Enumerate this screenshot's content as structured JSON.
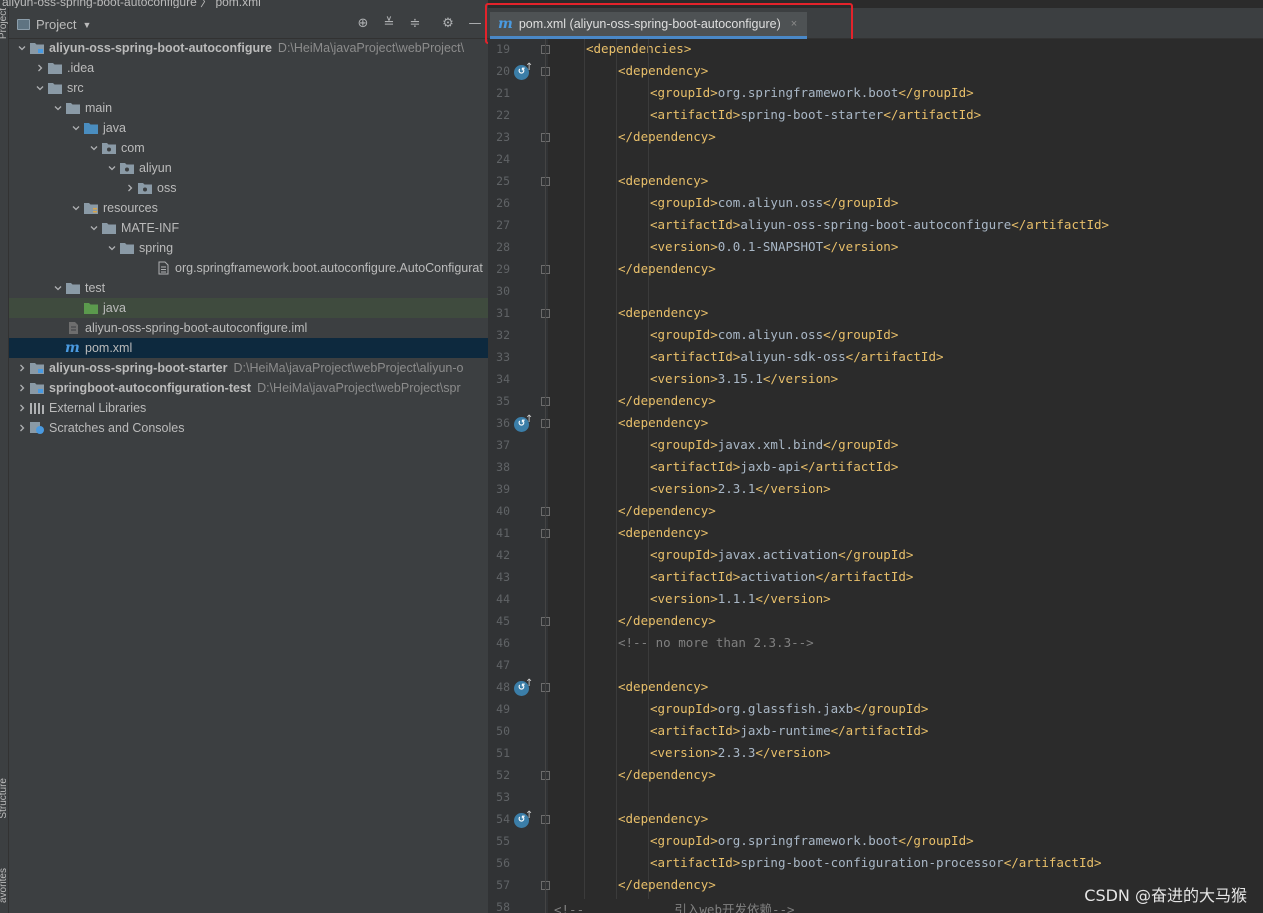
{
  "breadcrumb": {
    "text": "aliyun-oss-spring-boot-autoconfigure  〉 pom.xml"
  },
  "tool_strip": {
    "top_label": "Project",
    "mid_label": "Structure",
    "bottom_label": "avorites"
  },
  "project_panel": {
    "title": "Project",
    "tree": [
      {
        "name": "aliyun-oss-spring-boot-autoconfigure",
        "path": "D:\\HeiMa\\javaProject\\webProject\\",
        "bold": true,
        "indent": 0,
        "chevron": "down",
        "icon": "module-folder",
        "state": ""
      },
      {
        "name": ".idea",
        "path": "",
        "bold": false,
        "indent": 1,
        "chevron": "right",
        "icon": "folder",
        "state": ""
      },
      {
        "name": "src",
        "path": "",
        "bold": false,
        "indent": 1,
        "chevron": "down",
        "icon": "folder",
        "state": ""
      },
      {
        "name": "main",
        "path": "",
        "bold": false,
        "indent": 2,
        "chevron": "down",
        "icon": "folder",
        "state": ""
      },
      {
        "name": "java",
        "path": "",
        "bold": false,
        "indent": 3,
        "chevron": "down",
        "icon": "source-folder",
        "state": ""
      },
      {
        "name": "com",
        "path": "",
        "bold": false,
        "indent": 4,
        "chevron": "down",
        "icon": "package",
        "state": ""
      },
      {
        "name": "aliyun",
        "path": "",
        "bold": false,
        "indent": 5,
        "chevron": "down",
        "icon": "package",
        "state": ""
      },
      {
        "name": "oss",
        "path": "",
        "bold": false,
        "indent": 6,
        "chevron": "right",
        "icon": "package",
        "state": ""
      },
      {
        "name": "resources",
        "path": "",
        "bold": false,
        "indent": 3,
        "chevron": "down",
        "icon": "resources-folder",
        "state": ""
      },
      {
        "name": "MATE-INF",
        "path": "",
        "bold": false,
        "indent": 4,
        "chevron": "down",
        "icon": "folder",
        "state": ""
      },
      {
        "name": "spring",
        "path": "",
        "bold": false,
        "indent": 5,
        "chevron": "down",
        "icon": "folder",
        "state": ""
      },
      {
        "name": "org.springframework.boot.autoconfigure.AutoConfigurat",
        "path": "",
        "bold": false,
        "indent": 7,
        "chevron": "none",
        "icon": "text-file",
        "state": ""
      },
      {
        "name": "test",
        "path": "",
        "bold": false,
        "indent": 2,
        "chevron": "down",
        "icon": "folder",
        "state": ""
      },
      {
        "name": "java",
        "path": "",
        "bold": false,
        "indent": 3,
        "chevron": "none",
        "icon": "test-folder",
        "state": "green"
      },
      {
        "name": "aliyun-oss-spring-boot-autoconfigure.iml",
        "path": "",
        "bold": false,
        "indent": 2,
        "chevron": "none",
        "icon": "iml-file",
        "state": ""
      },
      {
        "name": "pom.xml",
        "path": "",
        "bold": false,
        "indent": 2,
        "chevron": "none",
        "icon": "maven-file",
        "state": "blue"
      },
      {
        "name": "aliyun-oss-spring-boot-starter",
        "path": "D:\\HeiMa\\javaProject\\webProject\\aliyun-o",
        "bold": true,
        "indent": 0,
        "chevron": "right",
        "icon": "module-folder",
        "state": ""
      },
      {
        "name": "springboot-autoconfiguration-test",
        "path": "D:\\HeiMa\\javaProject\\webProject\\spr",
        "bold": true,
        "indent": 0,
        "chevron": "right",
        "icon": "module-folder",
        "state": ""
      },
      {
        "name": "External Libraries",
        "path": "",
        "bold": false,
        "indent": 0,
        "chevron": "right",
        "icon": "libraries",
        "state": ""
      },
      {
        "name": "Scratches and Consoles",
        "path": "",
        "bold": false,
        "indent": 0,
        "chevron": "right",
        "icon": "scratches",
        "state": ""
      }
    ]
  },
  "editor": {
    "tab_label": "pom.xml (aliyun-oss-spring-boot-autoconfigure)",
    "tab_close": "×",
    "lines": [
      {
        "n": "19",
        "indent": 1,
        "parts": [
          [
            "t",
            "<dependencies>"
          ]
        ],
        "fold": true,
        "mark": false
      },
      {
        "n": "20",
        "indent": 2,
        "parts": [
          [
            "t",
            "<dependency>"
          ]
        ],
        "fold": true,
        "mark": true
      },
      {
        "n": "21",
        "indent": 3,
        "parts": [
          [
            "t",
            "<groupId>"
          ],
          [
            "x",
            "org.springframework.boot"
          ],
          [
            "t",
            "</groupId>"
          ]
        ],
        "fold": false,
        "mark": false
      },
      {
        "n": "22",
        "indent": 3,
        "parts": [
          [
            "t",
            "<artifactId>"
          ],
          [
            "x",
            "spring-boot-starter"
          ],
          [
            "t",
            "</artifactId>"
          ]
        ],
        "fold": false,
        "mark": false
      },
      {
        "n": "23",
        "indent": 2,
        "parts": [
          [
            "t",
            "</dependency>"
          ]
        ],
        "fold": true,
        "mark": false
      },
      {
        "n": "24",
        "indent": 0,
        "parts": [],
        "fold": false,
        "mark": false
      },
      {
        "n": "25",
        "indent": 2,
        "parts": [
          [
            "t",
            "<dependency>"
          ]
        ],
        "fold": true,
        "mark": false
      },
      {
        "n": "26",
        "indent": 3,
        "parts": [
          [
            "t",
            "<groupId>"
          ],
          [
            "x",
            "com.aliyun.oss"
          ],
          [
            "t",
            "</groupId>"
          ]
        ],
        "fold": false,
        "mark": false
      },
      {
        "n": "27",
        "indent": 3,
        "parts": [
          [
            "t",
            "<artifactId>"
          ],
          [
            "x",
            "aliyun-oss-spring-boot-autoconfigure"
          ],
          [
            "t",
            "</artifactId>"
          ]
        ],
        "fold": false,
        "mark": false
      },
      {
        "n": "28",
        "indent": 3,
        "parts": [
          [
            "t",
            "<version>"
          ],
          [
            "x",
            "0.0.1-SNAPSHOT"
          ],
          [
            "t",
            "</version>"
          ]
        ],
        "fold": false,
        "mark": false
      },
      {
        "n": "29",
        "indent": 2,
        "parts": [
          [
            "t",
            "</dependency>"
          ]
        ],
        "fold": true,
        "mark": false
      },
      {
        "n": "30",
        "indent": 0,
        "parts": [],
        "fold": false,
        "mark": false
      },
      {
        "n": "31",
        "indent": 2,
        "parts": [
          [
            "t",
            "<dependency>"
          ]
        ],
        "fold": true,
        "mark": false
      },
      {
        "n": "32",
        "indent": 3,
        "parts": [
          [
            "t",
            "<groupId>"
          ],
          [
            "x",
            "com.aliyun.oss"
          ],
          [
            "t",
            "</groupId>"
          ]
        ],
        "fold": false,
        "mark": false
      },
      {
        "n": "33",
        "indent": 3,
        "parts": [
          [
            "t",
            "<artifactId>"
          ],
          [
            "x",
            "aliyun-sdk-oss"
          ],
          [
            "t",
            "</artifactId>"
          ]
        ],
        "fold": false,
        "mark": false
      },
      {
        "n": "34",
        "indent": 3,
        "parts": [
          [
            "t",
            "<version>"
          ],
          [
            "x",
            "3.15.1"
          ],
          [
            "t",
            "</version>"
          ]
        ],
        "fold": false,
        "mark": false
      },
      {
        "n": "35",
        "indent": 2,
        "parts": [
          [
            "t",
            "</dependency>"
          ]
        ],
        "fold": true,
        "mark": false
      },
      {
        "n": "36",
        "indent": 2,
        "parts": [
          [
            "t",
            "<dependency>"
          ]
        ],
        "fold": true,
        "mark": true
      },
      {
        "n": "37",
        "indent": 3,
        "parts": [
          [
            "t",
            "<groupId>"
          ],
          [
            "x",
            "javax.xml.bind"
          ],
          [
            "t",
            "</groupId>"
          ]
        ],
        "fold": false,
        "mark": false
      },
      {
        "n": "38",
        "indent": 3,
        "parts": [
          [
            "t",
            "<artifactId>"
          ],
          [
            "x",
            "jaxb-api"
          ],
          [
            "t",
            "</artifactId>"
          ]
        ],
        "fold": false,
        "mark": false
      },
      {
        "n": "39",
        "indent": 3,
        "parts": [
          [
            "t",
            "<version>"
          ],
          [
            "x",
            "2.3.1"
          ],
          [
            "t",
            "</version>"
          ]
        ],
        "fold": false,
        "mark": false
      },
      {
        "n": "40",
        "indent": 2,
        "parts": [
          [
            "t",
            "</dependency>"
          ]
        ],
        "fold": true,
        "mark": false
      },
      {
        "n": "41",
        "indent": 2,
        "parts": [
          [
            "t",
            "<dependency>"
          ]
        ],
        "fold": true,
        "mark": false
      },
      {
        "n": "42",
        "indent": 3,
        "parts": [
          [
            "t",
            "<groupId>"
          ],
          [
            "x",
            "javax.activation"
          ],
          [
            "t",
            "</groupId>"
          ]
        ],
        "fold": false,
        "mark": false
      },
      {
        "n": "43",
        "indent": 3,
        "parts": [
          [
            "t",
            "<artifactId>"
          ],
          [
            "x",
            "activation"
          ],
          [
            "t",
            "</artifactId>"
          ]
        ],
        "fold": false,
        "mark": false
      },
      {
        "n": "44",
        "indent": 3,
        "parts": [
          [
            "t",
            "<version>"
          ],
          [
            "x",
            "1.1.1"
          ],
          [
            "t",
            "</version>"
          ]
        ],
        "fold": false,
        "mark": false
      },
      {
        "n": "45",
        "indent": 2,
        "parts": [
          [
            "t",
            "</dependency>"
          ]
        ],
        "fold": true,
        "mark": false
      },
      {
        "n": "46",
        "indent": 2,
        "parts": [
          [
            "c",
            "<!-- no more than 2.3.3-->"
          ]
        ],
        "fold": false,
        "mark": false
      },
      {
        "n": "47",
        "indent": 0,
        "parts": [],
        "fold": false,
        "mark": false
      },
      {
        "n": "48",
        "indent": 2,
        "parts": [
          [
            "t",
            "<dependency>"
          ]
        ],
        "fold": true,
        "mark": true
      },
      {
        "n": "49",
        "indent": 3,
        "parts": [
          [
            "t",
            "<groupId>"
          ],
          [
            "x",
            "org.glassfish.jaxb"
          ],
          [
            "t",
            "</groupId>"
          ]
        ],
        "fold": false,
        "mark": false
      },
      {
        "n": "50",
        "indent": 3,
        "parts": [
          [
            "t",
            "<artifactId>"
          ],
          [
            "x",
            "jaxb-runtime"
          ],
          [
            "t",
            "</artifactId>"
          ]
        ],
        "fold": false,
        "mark": false
      },
      {
        "n": "51",
        "indent": 3,
        "parts": [
          [
            "t",
            "<version>"
          ],
          [
            "x",
            "2.3.3"
          ],
          [
            "t",
            "</version>"
          ]
        ],
        "fold": false,
        "mark": false
      },
      {
        "n": "52",
        "indent": 2,
        "parts": [
          [
            "t",
            "</dependency>"
          ]
        ],
        "fold": true,
        "mark": false
      },
      {
        "n": "53",
        "indent": 0,
        "parts": [],
        "fold": false,
        "mark": false
      },
      {
        "n": "54",
        "indent": 2,
        "parts": [
          [
            "t",
            "<dependency>"
          ]
        ],
        "fold": true,
        "mark": true
      },
      {
        "n": "55",
        "indent": 3,
        "parts": [
          [
            "t",
            "<groupId>"
          ],
          [
            "x",
            "org.springframework.boot"
          ],
          [
            "t",
            "</groupId>"
          ]
        ],
        "fold": false,
        "mark": false
      },
      {
        "n": "56",
        "indent": 3,
        "parts": [
          [
            "t",
            "<artifactId>"
          ],
          [
            "x",
            "spring-boot-configuration-processor"
          ],
          [
            "t",
            "</artifactId>"
          ]
        ],
        "fold": false,
        "mark": false
      },
      {
        "n": "57",
        "indent": 2,
        "parts": [
          [
            "t",
            "</dependency>"
          ]
        ],
        "fold": true,
        "mark": false
      },
      {
        "n": "58",
        "indent": 0,
        "parts": [
          [
            "c",
            "<!--            引入web开发依赖-->"
          ]
        ],
        "fold": false,
        "mark": false
      }
    ]
  },
  "watermark": "CSDN @奋进的大马猴",
  "colors": {
    "tag": "#e8bf6a",
    "text": "#a9b7c6",
    "comment": "#808080",
    "accent": "#4a88c7",
    "highlight_border": "#e4232b"
  }
}
